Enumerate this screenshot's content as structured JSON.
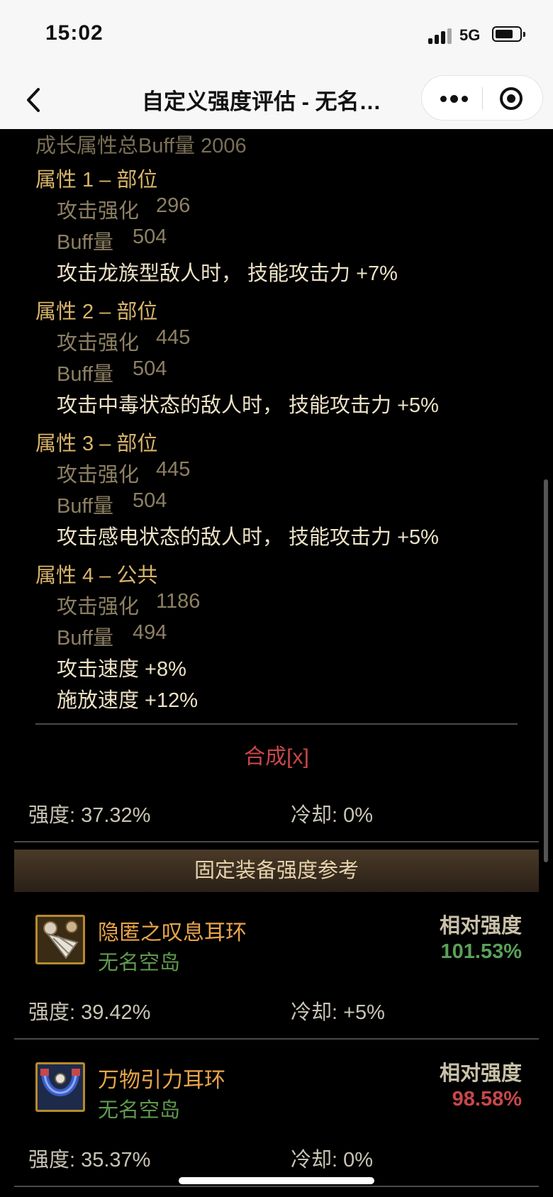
{
  "status_bar": {
    "time": "15:02",
    "network": "5G"
  },
  "nav": {
    "title": "自定义强度评估 - 无名…"
  },
  "summary_partial": "成长属性总Buff量 2006",
  "attributes": [
    {
      "title": "属性 1 – 部位",
      "attack_label": "攻击强化",
      "attack_value": "296",
      "buff_label": "Buff量",
      "buff_value": "504",
      "effects": [
        "攻击龙族型敌人时， 技能攻击力 +7%"
      ]
    },
    {
      "title": "属性 2 – 部位",
      "attack_label": "攻击强化",
      "attack_value": "445",
      "buff_label": "Buff量",
      "buff_value": "504",
      "effects": [
        "攻击中毒状态的敌人时， 技能攻击力 +5%"
      ]
    },
    {
      "title": "属性 3 – 部位",
      "attack_label": "攻击强化",
      "attack_value": "445",
      "buff_label": "Buff量",
      "buff_value": "504",
      "effects": [
        "攻击感电状态的敌人时， 技能攻击力 +5%"
      ]
    },
    {
      "title": "属性 4 – 公共",
      "attack_label": "攻击强化",
      "attack_value": "1186",
      "buff_label": "Buff量",
      "buff_value": "494",
      "effects": [
        "攻击速度 +8%",
        "施放速度 +12%"
      ]
    }
  ],
  "compose_label": "合成[x]",
  "current": {
    "strength": "强度: 37.32%",
    "cooldown": "冷却: 0%"
  },
  "section_header": "固定装备强度参考",
  "items": [
    {
      "name": "隐匿之叹息耳环",
      "source": "无名空岛",
      "rel_label": "相对强度",
      "rel_value": "101.53%",
      "rel_color": "#5aa05a",
      "strength": "强度: 39.42%",
      "cooldown": "冷却: +5%",
      "icon": "earring-icon"
    },
    {
      "name": "万物引力耳环",
      "source": "无名空岛",
      "rel_label": "相对强度",
      "rel_value": "98.58%",
      "rel_color": "#c8474a",
      "strength": "强度: 35.37%",
      "cooldown": "冷却: 0%",
      "icon": "magnet-earring-icon"
    }
  ]
}
